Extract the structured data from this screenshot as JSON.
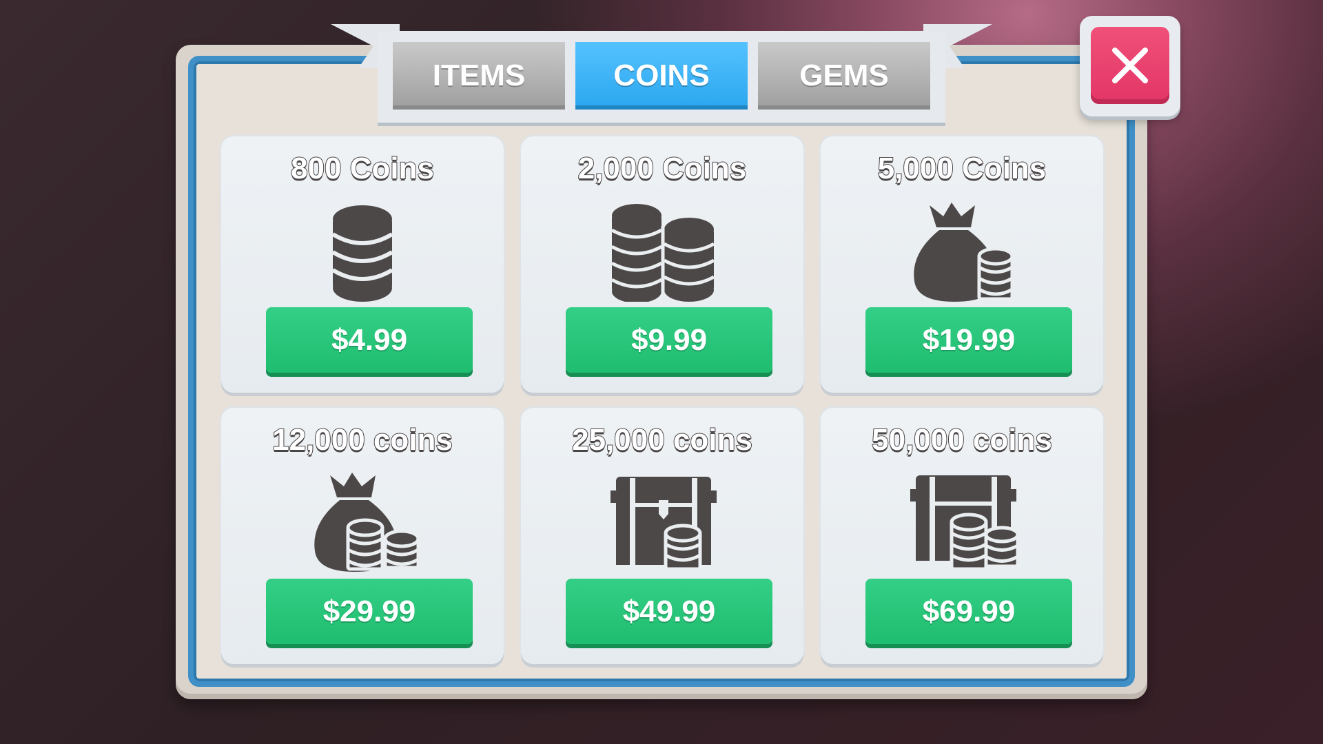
{
  "tabs": [
    {
      "label": "ITEMS",
      "active": false
    },
    {
      "label": "COINS",
      "active": true
    },
    {
      "label": "GEMS",
      "active": false
    }
  ],
  "close_icon": "close-x-icon",
  "colors": {
    "tab_active": "#3fb5f8",
    "tab_inactive": "#b5b5b5",
    "buy_button": "#27c679",
    "close_button": "#e9416f",
    "icon_fill": "#4d4848",
    "frame_blue": "#3f90c7"
  },
  "packs": [
    {
      "title": "800 Coins",
      "price": "$4.99",
      "icon": "coin-stack-icon"
    },
    {
      "title": "2,000 Coins",
      "price": "$9.99",
      "icon": "coin-stacks-icon"
    },
    {
      "title": "5,000 Coins",
      "price": "$19.99",
      "icon": "money-bag-icon"
    },
    {
      "title": "12,000 coins",
      "price": "$29.99",
      "icon": "money-bag-coins-icon"
    },
    {
      "title": "25,000 coins",
      "price": "$49.99",
      "icon": "treasure-chest-icon"
    },
    {
      "title": "50,000 coins",
      "price": "$69.99",
      "icon": "treasure-chest-coins-icon"
    }
  ]
}
